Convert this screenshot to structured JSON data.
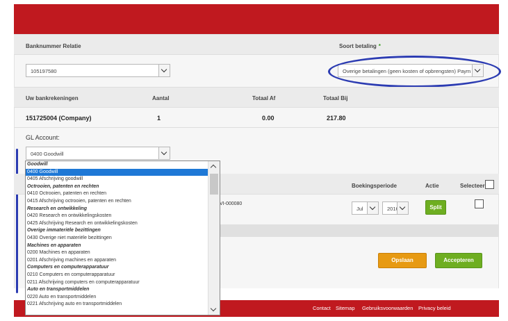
{
  "form": {
    "banknummer_label": "Banknummer Relatie",
    "soort_label": "Soort betaling",
    "soort_required": "*",
    "banknummer_value": "105197580",
    "soort_value": "Overige betalingen (geen kosten of opbrengsten) Paym"
  },
  "accounts_table": {
    "headers": [
      "Uw bankrekeningen",
      "Aantal",
      "Totaal Af",
      "Totaal Bij"
    ],
    "row": [
      "151725004 (Company)",
      "1",
      "0.00",
      "217.80"
    ]
  },
  "gl": {
    "label": "GL Account:",
    "value": "0400 Goodwill"
  },
  "dropdown": {
    "items": [
      {
        "text": "Goodwill",
        "type": "group"
      },
      {
        "text": "0400 Goodwill",
        "type": "selected"
      },
      {
        "text": "0405 Afschrijving goodwill",
        "type": "item"
      },
      {
        "text": "Octrooien, patenten en rechten",
        "type": "group"
      },
      {
        "text": "0410 Octrooien, patenten en rechten",
        "type": "item"
      },
      {
        "text": "0415 Afschrijving octrooien, patenten en rechten",
        "type": "item"
      },
      {
        "text": "Research en ontwikkeling",
        "type": "group"
      },
      {
        "text": "0420 Research en ontwikkelingskosten",
        "type": "item"
      },
      {
        "text": "0425 Afschrijving Research en ontwikkelingskosten",
        "type": "item"
      },
      {
        "text": "Overige immateriële bezittingen",
        "type": "group"
      },
      {
        "text": "0430 Overige niet materiële bezittingen",
        "type": "item"
      },
      {
        "text": "Machines en apparaten",
        "type": "group"
      },
      {
        "text": "0200 Machines en apparaten",
        "type": "item"
      },
      {
        "text": "0201 Afschrijving machines en apparaten",
        "type": "item"
      },
      {
        "text": "Computers en computerapparatuur",
        "type": "group"
      },
      {
        "text": "0210 Computers en computerapparatuur",
        "type": "item"
      },
      {
        "text": "0211 Afschrijving computers en computerapparatuur",
        "type": "item"
      },
      {
        "text": "Auto en transportmiddelen",
        "type": "group"
      },
      {
        "text": "0220 Auto en transportmiddelen",
        "type": "item"
      },
      {
        "text": "0221 Afschrijving auto en transportmiddelen",
        "type": "item"
      }
    ]
  },
  "transactions": {
    "headers": {
      "boekingsperiode": "Boekingsperiode",
      "actie": "Actie",
      "selecteer": "Selecteer"
    },
    "row": {
      "reference": "VI-000080",
      "month": "Jul",
      "year": "2016",
      "split_label": "Split"
    }
  },
  "buttons": {
    "opslaan": "Opslaan",
    "accepteren": "Accepteren"
  },
  "footer": {
    "links": [
      "Contact",
      "Sitemap",
      "Gebruiksvoorwaarden",
      "Privacy beleid"
    ]
  },
  "colors": {
    "brand_red": "#c0191f",
    "annotation_blue": "#2c3cb2",
    "accent_green": "#6eae21",
    "accent_orange": "#e79a13",
    "selection_blue": "#1e78d6"
  }
}
